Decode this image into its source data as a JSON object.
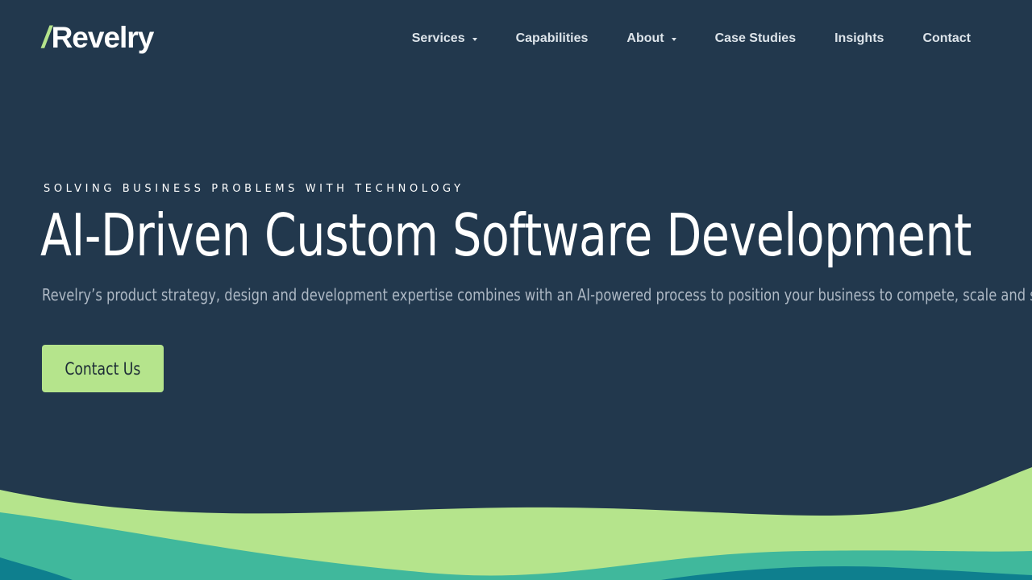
{
  "brand": {
    "logo_mark": "/",
    "logo_text": "Revelry"
  },
  "nav": {
    "items": [
      {
        "label": "Services",
        "has_dropdown": true
      },
      {
        "label": "Capabilities",
        "has_dropdown": false
      },
      {
        "label": "About",
        "has_dropdown": true
      },
      {
        "label": "Case Studies",
        "has_dropdown": false
      },
      {
        "label": "Insights",
        "has_dropdown": false
      },
      {
        "label": "Contact",
        "has_dropdown": false
      }
    ]
  },
  "hero": {
    "eyebrow": "SOLVING BUSINESS PROBLEMS WITH TECHNOLOGY",
    "headline": "AI-Driven Custom Software Development",
    "subhead": "Revelry’s product strategy, design and development expertise combines with an AI-powered process to position your business to compete, scale and succeed",
    "cta_label": "Contact Us"
  },
  "colors": {
    "background": "#22384d",
    "accent_green": "#b5e48c",
    "teal": "#40b89c",
    "deep_teal": "#0e7f8e"
  }
}
